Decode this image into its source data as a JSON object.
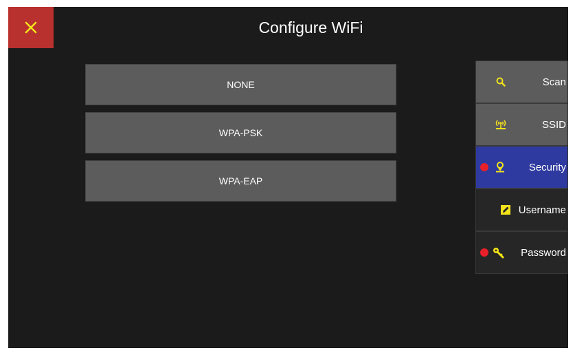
{
  "header": {
    "title": "Configure WiFi",
    "close_label": "×"
  },
  "options": [
    {
      "label": "NONE"
    },
    {
      "label": "WPA-PSK"
    },
    {
      "label": "WPA-EAP"
    }
  ],
  "sidebar": {
    "items": [
      {
        "label": "Scan",
        "icon": "search-icon",
        "state": "normal",
        "required": false
      },
      {
        "label": "SSID",
        "icon": "broadcast-icon",
        "state": "normal",
        "required": false
      },
      {
        "label": "Security",
        "icon": "pin-icon",
        "state": "active",
        "required": true
      },
      {
        "label": "Username",
        "icon": "edit-icon",
        "state": "dark",
        "required": false
      },
      {
        "label": "Password",
        "icon": "key-icon",
        "state": "dark",
        "required": true
      }
    ]
  },
  "colors": {
    "background": "#1b1b1b",
    "close_button": "#b8312f",
    "accent_icon": "#f2e21a",
    "active_item": "#2e3a9f",
    "button": "#5c5c5c",
    "required_dot": "#e8202a"
  }
}
